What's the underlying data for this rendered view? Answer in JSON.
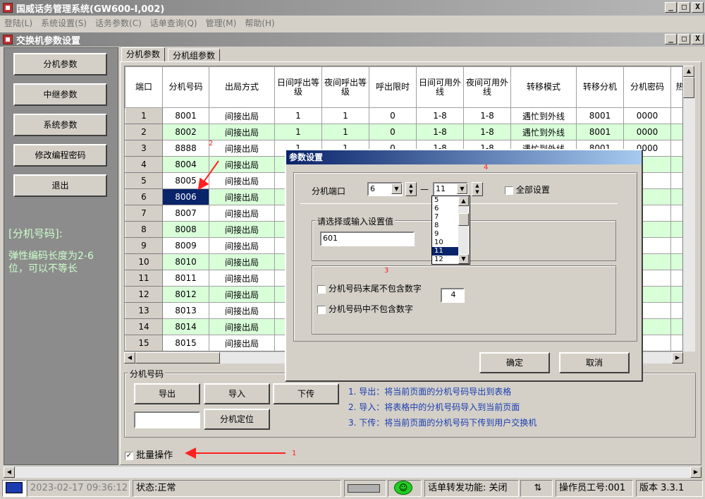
{
  "app": {
    "title": "国威话务管理系统(GW600-I,002)"
  },
  "menu": [
    "登陆(L)",
    "系统设置(S)",
    "话务参数(C)",
    "话单查询(Q)",
    "管理(M)",
    "帮助(H)"
  ],
  "window": {
    "title": "交换机参数设置"
  },
  "window_buttons": [
    "_",
    "□",
    "X"
  ],
  "left": {
    "buttons": [
      "分机参数",
      "中继参数",
      "系统参数",
      "修改编程密码",
      "退出"
    ],
    "info_title": "[分机号码]:",
    "info_lines": [
      "弹性编码长度为2-6",
      "位，可以不等长"
    ]
  },
  "tabs": [
    "分机参数",
    "分机组参数"
  ],
  "table": {
    "headers": [
      "端口",
      "分机号码",
      "出局方式",
      "日间呼出等级",
      "夜间呼出等级",
      "呼出限时",
      "日间可用外线",
      "夜间可用外线",
      "转移模式",
      "转移分机",
      "分机密码",
      "热"
    ],
    "rows": [
      [
        "1",
        "8001",
        "间接出局",
        "1",
        "1",
        "0",
        "1-8",
        "1-8",
        "遇忙到外线",
        "8001",
        "0000"
      ],
      [
        "2",
        "8002",
        "间接出局",
        "1",
        "1",
        "0",
        "1-8",
        "1-8",
        "遇忙到外线",
        "8001",
        "0000"
      ],
      [
        "3",
        "8888",
        "间接出局",
        "1",
        "1",
        "0",
        "1-8",
        "1-8",
        "遇忙到外线",
        "8001",
        "0000"
      ],
      [
        "4",
        "8004",
        "间接出局",
        "",
        "",
        "",
        "",
        "",
        "",
        "",
        ""
      ],
      [
        "5",
        "8005",
        "间接出局",
        "",
        "",
        "",
        "",
        "",
        "",
        "",
        ""
      ],
      [
        "6",
        "8006",
        "间接出局",
        "",
        "",
        "",
        "",
        "",
        "",
        "",
        ""
      ],
      [
        "7",
        "8007",
        "间接出局",
        "",
        "",
        "",
        "",
        "",
        "",
        "",
        ""
      ],
      [
        "8",
        "8008",
        "间接出局",
        "",
        "",
        "",
        "",
        "",
        "",
        "",
        ""
      ],
      [
        "9",
        "8009",
        "间接出局",
        "",
        "",
        "",
        "",
        "",
        "",
        "",
        ""
      ],
      [
        "10",
        "8010",
        "间接出局",
        "",
        "",
        "",
        "",
        "",
        "",
        "",
        ""
      ],
      [
        "11",
        "8011",
        "间接出局",
        "",
        "",
        "",
        "",
        "",
        "",
        "",
        ""
      ],
      [
        "12",
        "8012",
        "间接出局",
        "",
        "",
        "",
        "",
        "",
        "",
        "",
        ""
      ],
      [
        "13",
        "8013",
        "间接出局",
        "",
        "",
        "",
        "",
        "",
        "",
        "",
        ""
      ],
      [
        "14",
        "8014",
        "间接出局",
        "",
        "",
        "",
        "",
        "",
        "",
        "",
        ""
      ],
      [
        "15",
        "8015",
        "间接出局",
        "",
        "",
        "",
        "",
        "",
        "",
        "",
        ""
      ]
    ],
    "selected_cell": {
      "row": 6,
      "col": 1
    }
  },
  "ext_group": {
    "label": "分机号码",
    "export": "导出",
    "import": "导入",
    "upload": "下传",
    "locate": "分机定位",
    "locate_value": "",
    "hints": [
      "1. 导出：将当前页面的分机号码导出到表格",
      "2. 导入：将表格中的分机号码导入到当前页面",
      "3. 下传：将当前页面的分机号码下传到用户交换机"
    ]
  },
  "batch": {
    "label": "批量操作",
    "checked": true
  },
  "dialog": {
    "title": "参数设置",
    "port_label": "分机端口",
    "port_from": "6",
    "port_sep": "—",
    "port_to": "11",
    "all_label": "全部设置",
    "group_label": "请选择或输入设置值",
    "value": "601",
    "opt1": "分机号码末尾不包含数字",
    "opt2": "分机号码中不包含数字",
    "digit_value": "4",
    "ok": "确定",
    "cancel": "取消",
    "list_items": [
      "5",
      "6",
      "7",
      "8",
      "9",
      "10",
      "11",
      "12"
    ],
    "list_selected": "11"
  },
  "annotations": [
    "1",
    "2",
    "3",
    "4"
  ],
  "status": {
    "datetime": "2023-02-17 09:36:12",
    "state": "状态:正常",
    "forward": "话单转发功能: 关闭",
    "operator": "操作员工号:001",
    "version": "版本 3.3.1"
  },
  "colors": {
    "selected": "#0a246a",
    "row_green": "#d9ffd9",
    "annotation": "#ff2020",
    "hint": "#1a3cb0"
  }
}
